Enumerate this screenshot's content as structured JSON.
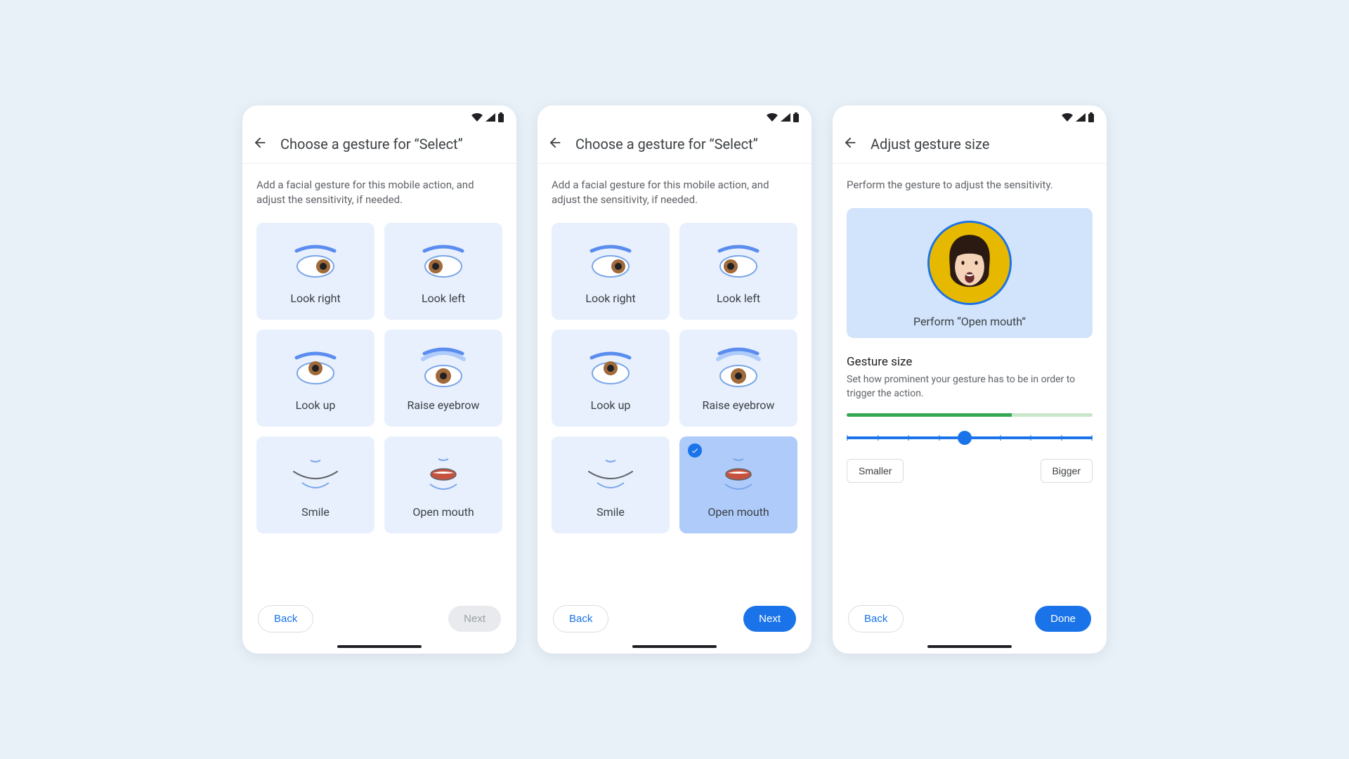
{
  "screens": [
    {
      "title": "Choose a gesture for “Select”",
      "description": "Add a facial gesture for this mobile action, and adjust the sensitivity, if needed.",
      "cards": [
        {
          "label": "Look right",
          "icon": "eye-right",
          "selected": false
        },
        {
          "label": "Look left",
          "icon": "eye-left",
          "selected": false
        },
        {
          "label": "Look up",
          "icon": "eye-up",
          "selected": false
        },
        {
          "label": "Raise eyebrow",
          "icon": "eyebrow",
          "selected": false
        },
        {
          "label": "Smile",
          "icon": "smile",
          "selected": false
        },
        {
          "label": "Open mouth",
          "icon": "open-mouth",
          "selected": false
        }
      ],
      "back": "Back",
      "next": "Next",
      "next_enabled": false
    },
    {
      "title": "Choose a gesture for “Select”",
      "description": "Add a facial gesture for this mobile action, and adjust the sensitivity, if needed.",
      "cards": [
        {
          "label": "Look right",
          "icon": "eye-right",
          "selected": false
        },
        {
          "label": "Look left",
          "icon": "eye-left",
          "selected": false
        },
        {
          "label": "Look up",
          "icon": "eye-up",
          "selected": false
        },
        {
          "label": "Raise eyebrow",
          "icon": "eyebrow",
          "selected": false
        },
        {
          "label": "Smile",
          "icon": "smile",
          "selected": false
        },
        {
          "label": "Open mouth",
          "icon": "open-mouth",
          "selected": true
        }
      ],
      "back": "Back",
      "next": "Next",
      "next_enabled": true
    },
    {
      "title": "Adjust gesture size",
      "description": "Perform the gesture to adjust the sensitivity.",
      "preview_label": "Perform “Open mouth”",
      "section_title": "Gesture size",
      "section_desc": "Set how prominent your gesture has to be in order to trigger the action.",
      "progress_percent": 67,
      "slider_percent": 48,
      "smaller": "Smaller",
      "bigger": "Bigger",
      "back": "Back",
      "done": "Done"
    }
  ]
}
